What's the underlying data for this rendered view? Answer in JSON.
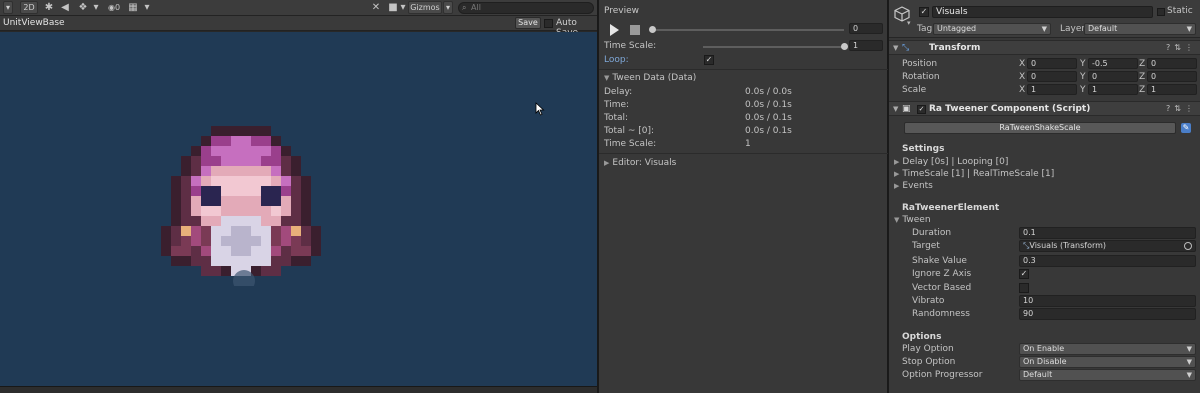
{
  "scene": {
    "toolbar": {
      "mode_2d": "2D",
      "light_icon": "lightbulb-icon",
      "audio_icon": "speaker-icon",
      "fx_icon": "effects-icon",
      "hidden_count": "0",
      "grid_icon": "grid-icon",
      "tools_icon": "tools-icon",
      "camera_icon": "camera-icon",
      "gizmos_label": "Gizmos",
      "search_placeholder": "All"
    },
    "header": {
      "title": "UnitViewBase",
      "save_label": "Save",
      "autosave_label": "Auto Save",
      "autosave_checked": false
    },
    "viewport_color": "#203a55"
  },
  "preview": {
    "title": "Preview",
    "time_value": "0",
    "time_fraction": 0.0,
    "timescale_label": "Time Scale:",
    "timescale_value": "1",
    "timescale_fraction": 1.0,
    "loop_label": "Loop:",
    "loop_checked": true,
    "tween_data": {
      "title": "Tween Data (Data)",
      "rows": [
        {
          "label": "Delay:",
          "value": "0.0s / 0.0s"
        },
        {
          "label": "Time:",
          "value": "0.0s / 0.1s"
        },
        {
          "label": "Total:",
          "value": "0.0s / 0.1s"
        },
        {
          "label": "Total ~ [0]:",
          "value": "0.0s / 0.1s"
        },
        {
          "label": "Time Scale:",
          "value": "1"
        }
      ]
    },
    "editor_foldout": "Editor: Visuals"
  },
  "inspector": {
    "object_name": "Visuals",
    "active": true,
    "static_label": "Static",
    "tag_label": "Tag",
    "tag_value": "Untagged",
    "layer_label": "Layer",
    "layer_value": "Default",
    "transform": {
      "title": "Transform",
      "rows": [
        {
          "label": "Position",
          "x": "0",
          "y": "-0.5",
          "z": "0"
        },
        {
          "label": "Rotation",
          "x": "0",
          "y": "0",
          "z": "0"
        },
        {
          "label": "Scale",
          "x": "1",
          "y": "1",
          "z": "1"
        }
      ],
      "axis_x": "X",
      "axis_y": "Y",
      "axis_z": "Z"
    },
    "tweener": {
      "title": "Ra Tweener Component (Script)",
      "script_button": "RaTweenShakeScale",
      "settings_title": "Settings",
      "settings_items": [
        "Delay [0s] | Looping [0]",
        "TimeScale [1] | RealTimeScale [1]",
        "Events"
      ],
      "element_title": "RaTweenerElement",
      "tween_foldout": "Tween",
      "fields": {
        "duration_label": "Duration",
        "duration": "0.1",
        "target_label": "Target",
        "target": "Visuals (Transform)",
        "shake_label": "Shake Value",
        "shake": "0.3",
        "ignorez_label": "Ignore Z Axis",
        "ignorez": true,
        "vector_label": "Vector Based",
        "vector": false,
        "vibrato_label": "Vibrato",
        "vibrato": "10",
        "randomness_label": "Randomness",
        "randomness": "90"
      },
      "options_title": "Options",
      "options": [
        {
          "label": "Play Option",
          "value": "On Enable"
        },
        {
          "label": "Stop Option",
          "value": "On Disable"
        },
        {
          "label": "Option Progressor",
          "value": "Default"
        }
      ]
    }
  }
}
